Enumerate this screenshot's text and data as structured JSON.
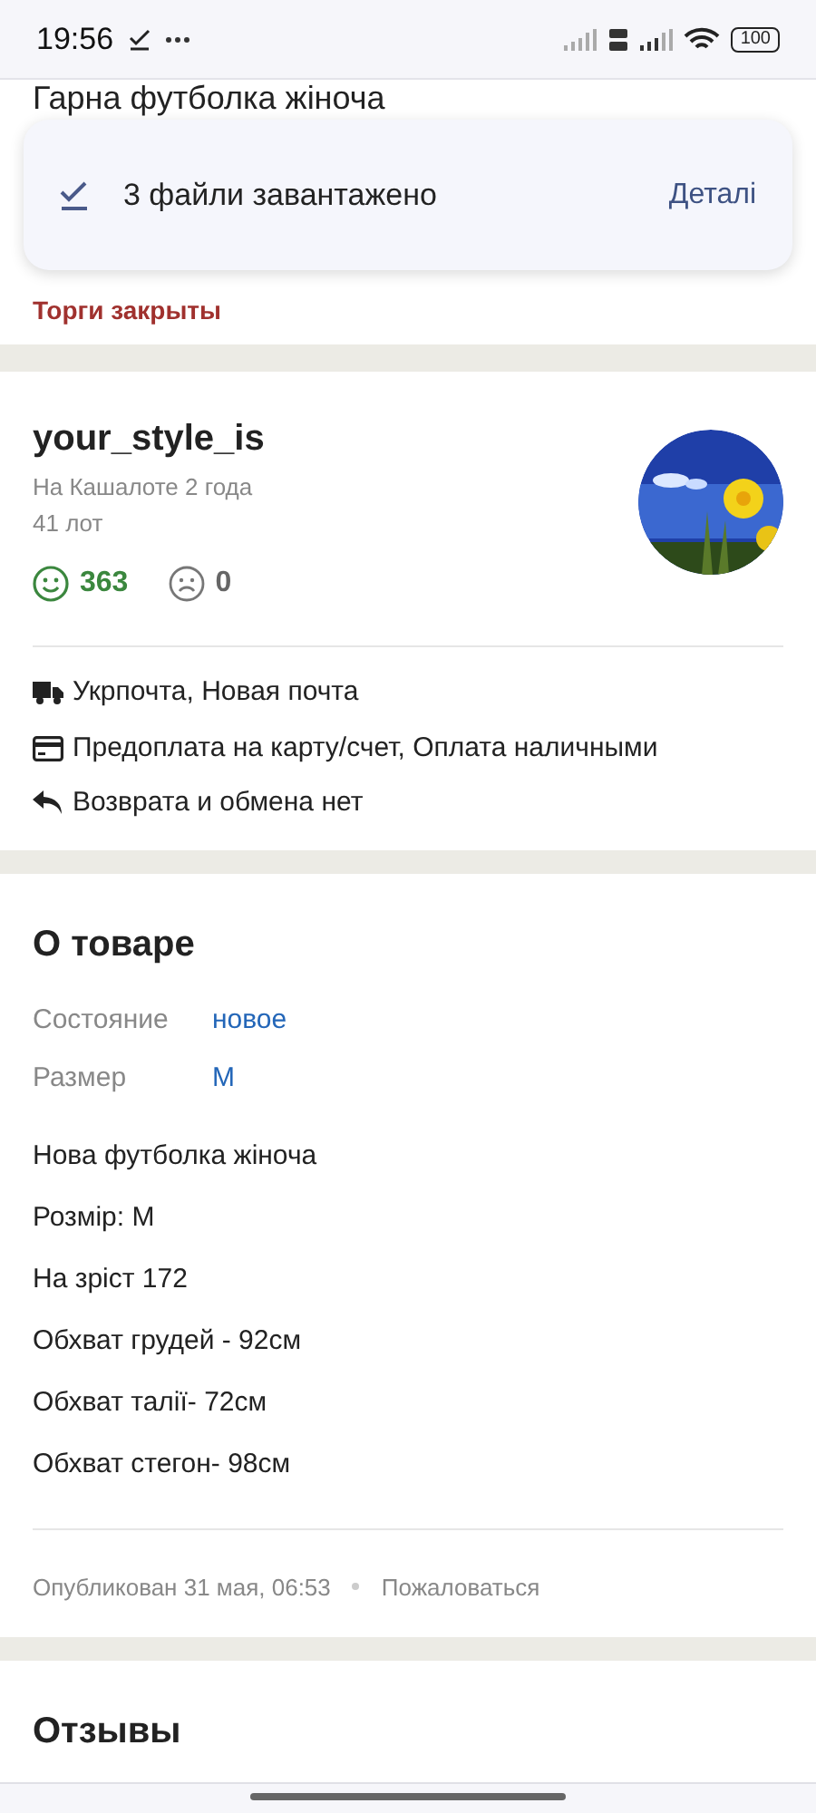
{
  "status_bar": {
    "time": "19:56",
    "battery": "100"
  },
  "item": {
    "title": "Гарна футболка жіноча",
    "auction_status": "Торги закрыты"
  },
  "toast": {
    "message": "3 файли завантажено",
    "action": "Деталі"
  },
  "seller": {
    "name": "your_style_is",
    "since": "На Кашалоте 2 года",
    "lots": "41 лот",
    "positive": "363",
    "negative": "0",
    "terms": [
      {
        "kind": "delivery",
        "text": "Укрпочта, Новая почта"
      },
      {
        "kind": "payment",
        "text": "Предоплата на карту/счет, Оплата наличными"
      },
      {
        "kind": "return",
        "text": "Возврата и обмена нет"
      }
    ]
  },
  "about": {
    "title": "О товаре",
    "attributes": [
      {
        "label": "Состояние",
        "value": "новое"
      },
      {
        "label": "Размер",
        "value": "M"
      }
    ],
    "description": [
      "Нова футболка жіноча",
      "Розмір: M",
      "На зріст 172",
      "Обхват грудей - 92см",
      "Обхват талії- 72см",
      "Обхват стегон- 98см"
    ],
    "published": "Опубликован 31 мая, 06:53",
    "report": "Пожаловаться"
  },
  "reviews": {
    "title": "Отзывы"
  }
}
